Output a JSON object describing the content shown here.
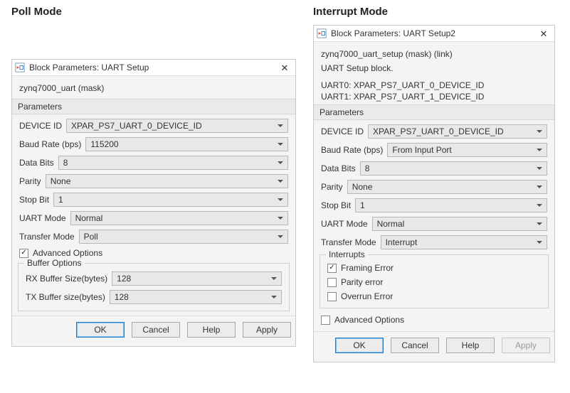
{
  "poll": {
    "mode_title": "Poll Mode",
    "window_title": "Block Parameters: UART Setup",
    "subtitle": "zynq7000_uart (mask)",
    "params_header": "Parameters",
    "device_id_label": "DEVICE ID",
    "device_id_value": "XPAR_PS7_UART_0_DEVICE_ID",
    "baud_label": "Baud Rate (bps)",
    "baud_value": "115200",
    "databits_label": "Data Bits",
    "databits_value": "8",
    "parity_label": "Parity",
    "parity_value": "None",
    "stopbit_label": "Stop Bit",
    "stopbit_value": "1",
    "uartmode_label": "UART Mode",
    "uartmode_value": "Normal",
    "transfer_label": "Transfer Mode",
    "transfer_value": "Poll",
    "advanced_label": "Advanced Options",
    "buffer_legend": "Buffer Options",
    "rx_label": "RX Buffer Size(bytes)",
    "rx_value": "128",
    "tx_label": "TX Buffer size(bytes)",
    "tx_value": "128",
    "buttons": {
      "ok": "OK",
      "cancel": "Cancel",
      "help": "Help",
      "apply": "Apply"
    }
  },
  "interrupt": {
    "mode_title": "Interrupt Mode",
    "window_title": "Block Parameters: UART Setup2",
    "subtitle": "zynq7000_uart_setup (mask) (link)",
    "desc1": "UART Setup block.",
    "desc2": "UART0: XPAR_PS7_UART_0_DEVICE_ID",
    "desc3": "UART1: XPAR_PS7_UART_1_DEVICE_ID",
    "params_header": "Parameters",
    "device_id_label": "DEVICE ID",
    "device_id_value": "XPAR_PS7_UART_0_DEVICE_ID",
    "baud_label": "Baud Rate (bps)",
    "baud_value": "From Input Port",
    "databits_label": "Data Bits",
    "databits_value": "8",
    "parity_label": "Parity",
    "parity_value": "None",
    "stopbit_label": "Stop Bit",
    "stopbit_value": "1",
    "uartmode_label": "UART Mode",
    "uartmode_value": "Normal",
    "transfer_label": "Transfer Mode",
    "transfer_value": "Interrupt",
    "interrupts_legend": "Interrupts",
    "framing_label": "Framing Error",
    "parityerr_label": "Parity error",
    "overrun_label": "Overrun Error",
    "advanced_label": "Advanced Options",
    "buttons": {
      "ok": "OK",
      "cancel": "Cancel",
      "help": "Help",
      "apply": "Apply"
    }
  }
}
